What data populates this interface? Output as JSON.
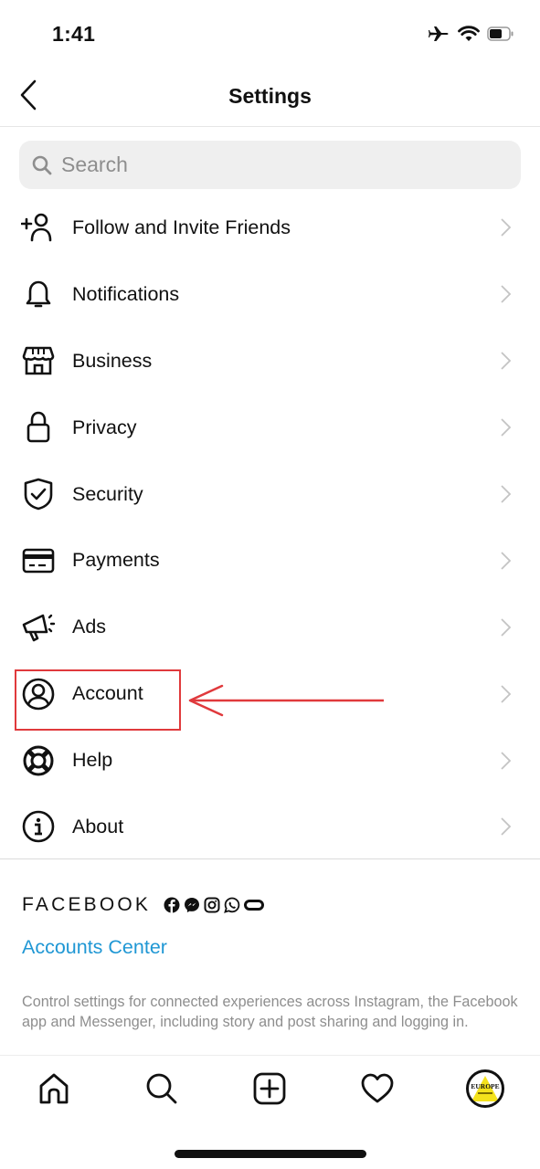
{
  "status_bar": {
    "time": "1:41",
    "icons": [
      "airplane-icon",
      "wifi-icon",
      "battery-icon"
    ],
    "battery_level": 0.6
  },
  "header": {
    "title": "Settings",
    "back_icon": "chevron-left-icon"
  },
  "search": {
    "placeholder": "Search",
    "value": ""
  },
  "menu": {
    "items": [
      {
        "label": "Follow and Invite Friends",
        "icon": "add-person-icon"
      },
      {
        "label": "Notifications",
        "icon": "bell-icon"
      },
      {
        "label": "Business",
        "icon": "storefront-icon"
      },
      {
        "label": "Privacy",
        "icon": "lock-icon"
      },
      {
        "label": "Security",
        "icon": "shield-check-icon"
      },
      {
        "label": "Payments",
        "icon": "credit-card-icon"
      },
      {
        "label": "Ads",
        "icon": "megaphone-icon"
      },
      {
        "label": "Account",
        "icon": "user-circle-icon"
      },
      {
        "label": "Help",
        "icon": "lifebuoy-icon"
      },
      {
        "label": "About",
        "icon": "info-icon"
      }
    ]
  },
  "facebook": {
    "wordmark": "FACEBOOK",
    "icons": [
      "facebook-icon",
      "messenger-icon",
      "instagram-icon",
      "whatsapp-icon",
      "oculus-icon"
    ],
    "accounts_center": "Accounts Center",
    "description": "Control settings for connected experiences across Instagram, the Facebook app and Messenger, including story and post sharing and logging in."
  },
  "bottom_nav": {
    "items": [
      "home-icon",
      "search-icon",
      "new-post-icon",
      "activity-heart-icon",
      "profile-avatar"
    ],
    "avatar_text": "EUROPE"
  },
  "annotation": {
    "highlighted_item": "Account",
    "color": "#e0393c"
  },
  "colors": {
    "link": "#1f97d4",
    "muted": "#8e8e8e",
    "search_bg": "#efefef"
  }
}
